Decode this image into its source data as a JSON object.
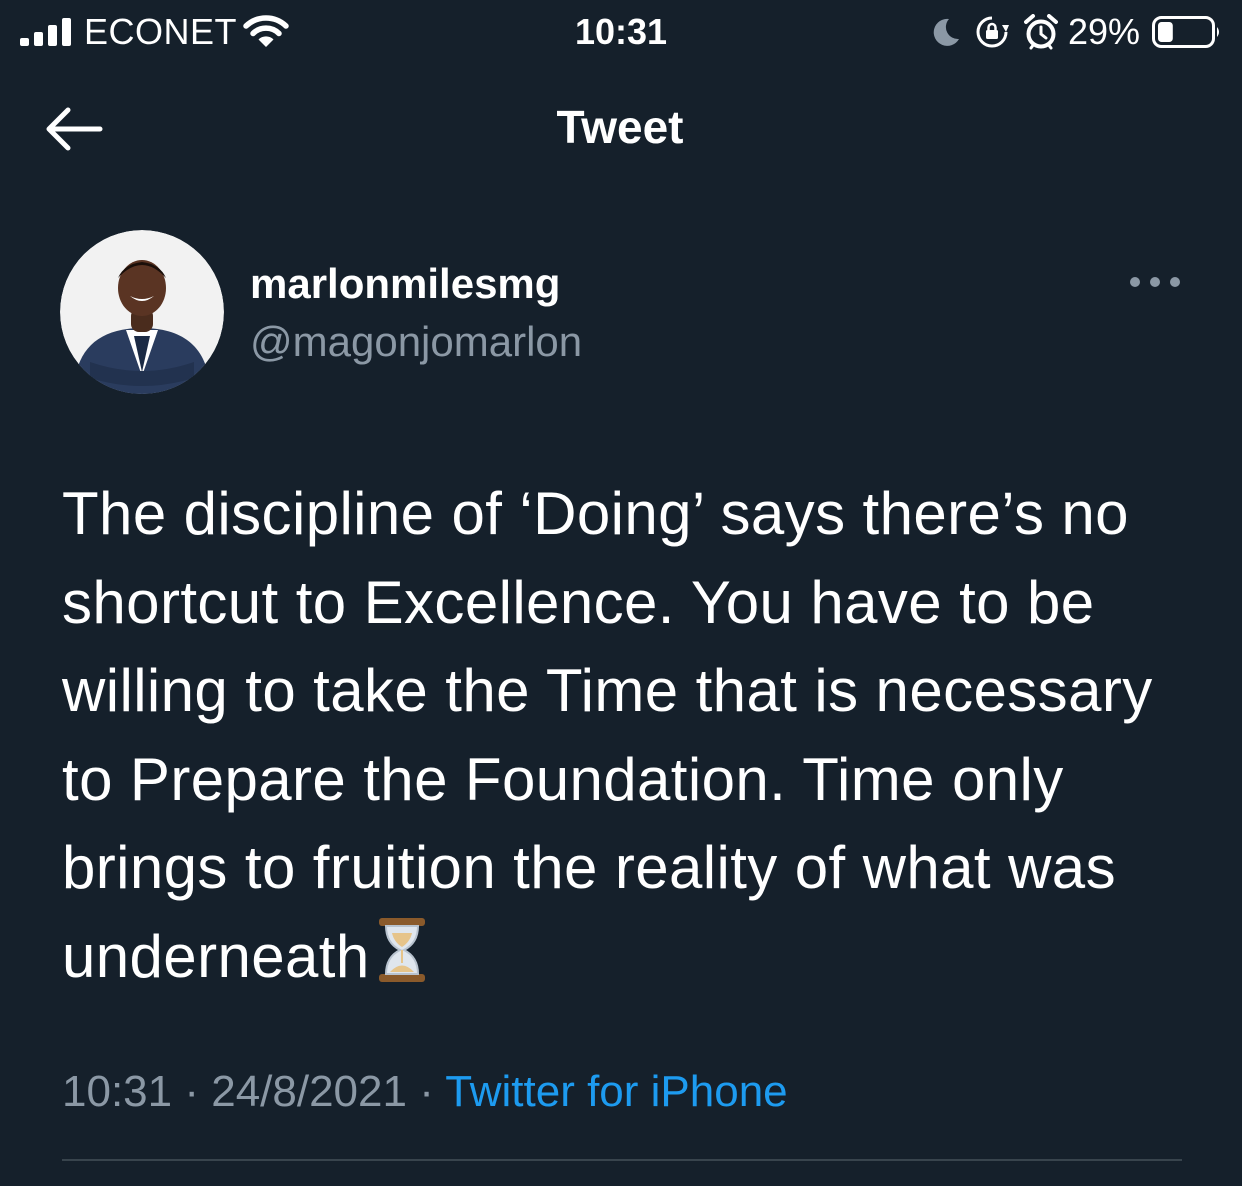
{
  "status_bar": {
    "carrier": "ECONET",
    "time": "10:31",
    "battery_percent": "29%",
    "battery_level": 0.29,
    "icons": [
      "signal-icon",
      "wifi-icon",
      "moon-icon",
      "orientation-lock-icon",
      "alarm-icon",
      "battery-icon"
    ]
  },
  "nav": {
    "title": "Tweet",
    "back_icon": "back-arrow-icon"
  },
  "tweet": {
    "display_name": "marlonmilesmg",
    "handle": "@magonjomarlon",
    "more_icon": "more-dots-icon",
    "text": "The discipline of ‘Doing’ says there’s no shortcut to Excellence. You have to be willing to take the Time that is necessary to Prepare the Foundation. Time only brings to fruition the reality of what was underneath",
    "emoji": "hourglass-emoji",
    "time": "10:31",
    "separator": " · ",
    "date": "24/8/2021",
    "source": "Twitter for iPhone"
  },
  "colors": {
    "background": "#15202b",
    "text": "#ffffff",
    "secondary_text": "#8b98a5",
    "link": "#1d9bf0",
    "divider": "#38444d"
  }
}
